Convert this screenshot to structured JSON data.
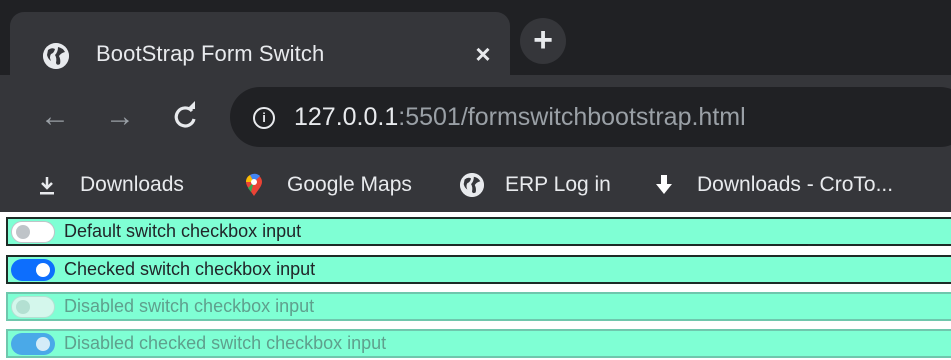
{
  "browser": {
    "tab": {
      "title": "BootStrap Form Switch",
      "close_glyph": "×",
      "icon": "globe-icon"
    },
    "new_tab_glyph": "+",
    "nav": {
      "back_glyph": "←",
      "forward_glyph": "→",
      "reload_glyph": "C"
    },
    "address": {
      "host": "127.0.0.1",
      "rest": ":5501/formswitchbootstrap.html",
      "info_glyph": "i"
    },
    "bookmarks": [
      {
        "label": "Downloads",
        "icon": "download-icon"
      },
      {
        "label": "Google Maps",
        "icon": "google-maps-pin-icon"
      },
      {
        "label": "ERP Log in",
        "icon": "globe-icon"
      },
      {
        "label": "Downloads - CroTo...",
        "icon": "download-arrow-icon"
      }
    ]
  },
  "switches": [
    {
      "label": "Default switch checkbox input",
      "checked": false,
      "disabled": false
    },
    {
      "label": "Checked switch checkbox input",
      "checked": true,
      "disabled": false
    },
    {
      "label": "Disabled switch checkbox input",
      "checked": false,
      "disabled": true
    },
    {
      "label": "Disabled checked switch checkbox input",
      "checked": true,
      "disabled": true
    }
  ],
  "colors": {
    "chrome_dark": "#202124",
    "chrome_toolbar": "#35363a",
    "row_background": "#7fffd4",
    "switch_checked": "#0d6efd"
  }
}
